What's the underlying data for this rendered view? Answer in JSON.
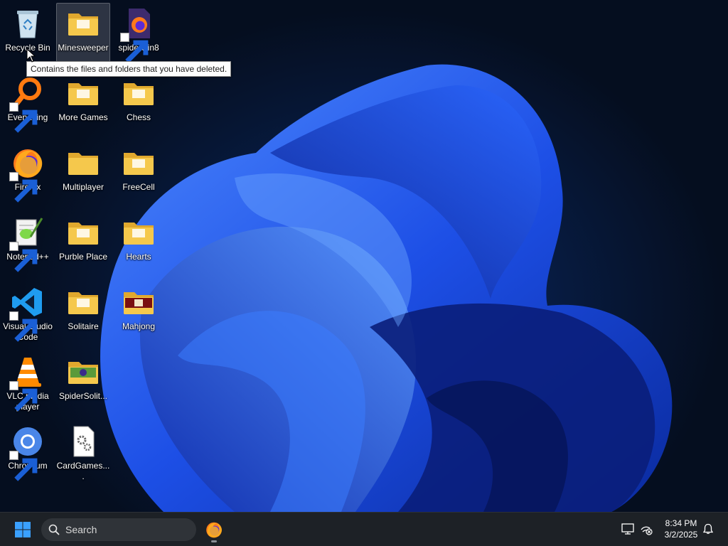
{
  "desktop": {
    "tooltip": "Contains the files and folders that you have deleted.",
    "icons": [
      {
        "id": "recycle-bin",
        "label": "Recycle Bin",
        "type": "recycle",
        "shortcut": false,
        "selected": false
      },
      {
        "id": "minesweeper",
        "label": "Minesweeper",
        "type": "folder",
        "shortcut": false,
        "selected": true
      },
      {
        "id": "spiderwin8",
        "label": "spiderwin8",
        "type": "firefox-file",
        "shortcut": true,
        "selected": false
      },
      {
        "id": "everything",
        "label": "Everything",
        "type": "everything",
        "shortcut": true,
        "selected": false
      },
      {
        "id": "more-games",
        "label": "More Games",
        "type": "folder",
        "shortcut": false,
        "selected": false
      },
      {
        "id": "chess",
        "label": "Chess",
        "type": "folder",
        "shortcut": false,
        "selected": false
      },
      {
        "id": "firefox",
        "label": "Firefox",
        "type": "firefox",
        "shortcut": true,
        "selected": false
      },
      {
        "id": "multiplayer",
        "label": "Multiplayer",
        "type": "folder-plain",
        "shortcut": false,
        "selected": false
      },
      {
        "id": "freecell",
        "label": "FreeCell",
        "type": "folder",
        "shortcut": false,
        "selected": false
      },
      {
        "id": "notepadpp",
        "label": "Notepad++",
        "type": "notepad",
        "shortcut": true,
        "selected": false
      },
      {
        "id": "purble-place",
        "label": "Purble Place",
        "type": "folder",
        "shortcut": false,
        "selected": false
      },
      {
        "id": "hearts",
        "label": "Hearts",
        "type": "folder",
        "shortcut": false,
        "selected": false
      },
      {
        "id": "vscode",
        "label": "Visual Studio Code",
        "type": "vscode",
        "shortcut": true,
        "selected": false
      },
      {
        "id": "solitaire",
        "label": "Solitaire",
        "type": "folder",
        "shortcut": false,
        "selected": false
      },
      {
        "id": "mahjong",
        "label": "Mahjong",
        "type": "folder-mahjong",
        "shortcut": false,
        "selected": false
      },
      {
        "id": "vlc",
        "label": "VLC media player",
        "type": "vlc",
        "shortcut": true,
        "selected": false
      },
      {
        "id": "spidersolitaire",
        "label": "SpiderSolit...",
        "type": "folder-spider",
        "shortcut": false,
        "selected": false
      },
      {
        "id": "chromium",
        "label": "Chromium",
        "type": "chromium",
        "shortcut": true,
        "selected": false
      },
      {
        "id": "cardgames",
        "label": "CardGames....",
        "type": "settings-file",
        "shortcut": false,
        "selected": false
      }
    ]
  },
  "taskbar": {
    "search_label": "Search",
    "time": "8:34 PM",
    "date": "3/2/2025"
  },
  "colors": {
    "folder": "#f5c84c",
    "folder_dark": "#e0a82e",
    "accent_blue": "#1e6bff",
    "taskbar": "#1d2126"
  }
}
